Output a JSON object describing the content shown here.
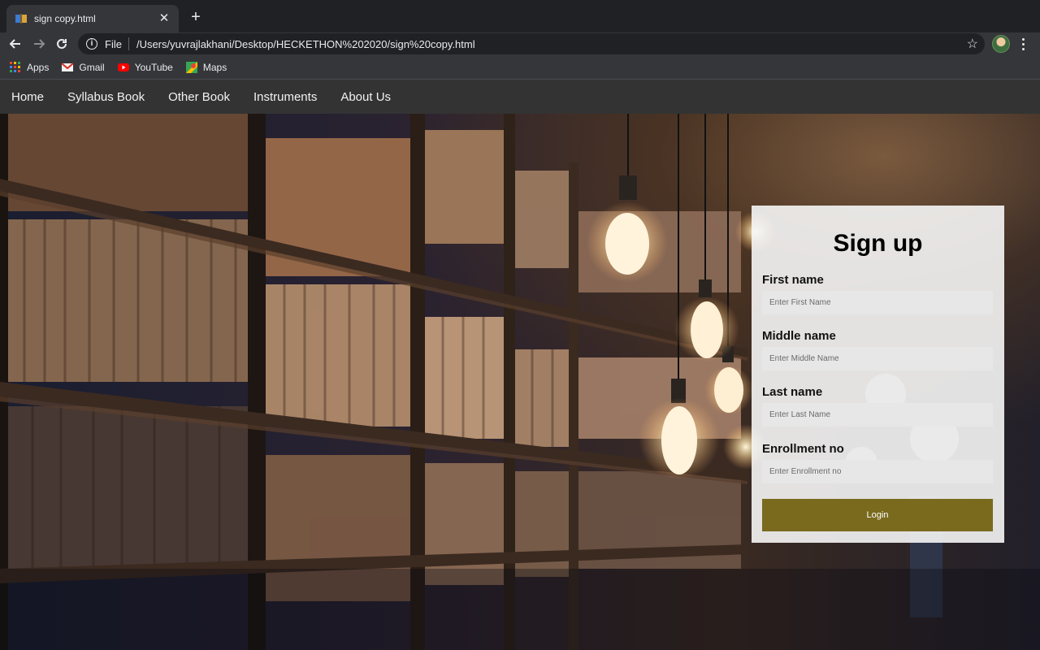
{
  "browser": {
    "tab_title": "sign copy.html",
    "address_scheme": "File",
    "address_url": "/Users/yuvrajlakhani/Desktop/HECKETHON%202020/sign%20copy.html",
    "bookmarks": [
      {
        "label": "Apps",
        "icon": "apps-grid-icon"
      },
      {
        "label": "Gmail",
        "icon": "gmail-icon"
      },
      {
        "label": "YouTube",
        "icon": "youtube-icon"
      },
      {
        "label": "Maps",
        "icon": "maps-icon"
      }
    ]
  },
  "nav": {
    "items": [
      "Home",
      "Syllabus Book",
      "Other Book",
      "Instruments",
      "About Us"
    ]
  },
  "form": {
    "title": "Sign up",
    "fields": [
      {
        "label": "First name",
        "placeholder": "Enter First Name"
      },
      {
        "label": "Middle name",
        "placeholder": "Enter Middle Name"
      },
      {
        "label": "Last name",
        "placeholder": "Enter Last Name"
      },
      {
        "label": "Enrollment no",
        "placeholder": "Enter Enrollment no"
      }
    ],
    "submit_label": "Login"
  },
  "colors": {
    "nav_bg": "#333333",
    "button_bg": "#7a6a1e",
    "chrome_bg": "#35363a"
  }
}
